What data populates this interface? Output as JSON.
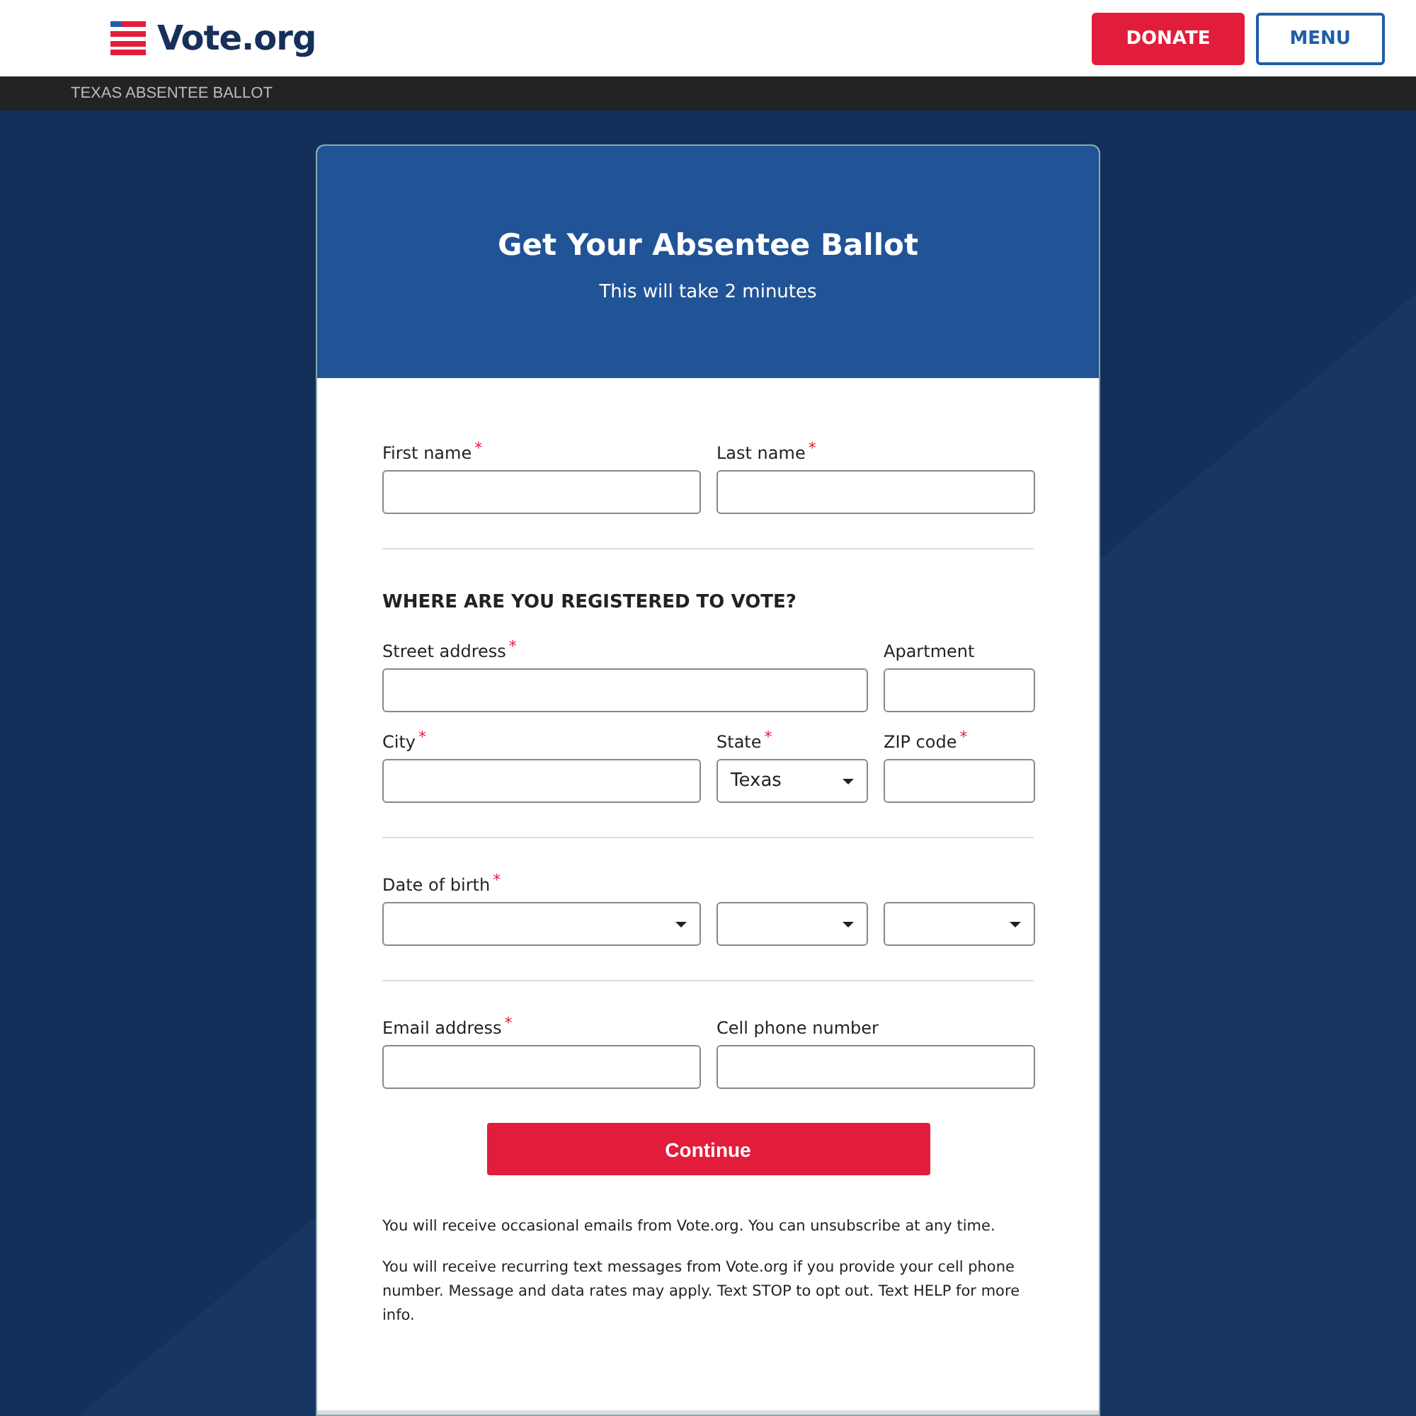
{
  "header": {
    "logo": "Vote.org",
    "buttons": [
      {
        "label": "DONATE",
        "kind": "primary"
      },
      {
        "label": "MENU",
        "kind": "outline"
      }
    ]
  },
  "breadcrumb": "TEXAS ABSENTEE BALLOT",
  "card": {
    "title": "Get Your Absentee Ballot",
    "subtitle": "This will take 2 minutes"
  },
  "sections": [
    {
      "fields": [
        {
          "label": "First name",
          "mark": "*",
          "kind": "text"
        },
        {
          "label": "Last name",
          "mark": "*",
          "kind": "text"
        }
      ]
    },
    {
      "heading": "WHERE ARE YOU REGISTERED TO VOTE?",
      "fields": [
        {
          "label": "Street address",
          "mark": "*",
          "kind": "text"
        },
        {
          "label": "Apartment",
          "kind": "text"
        },
        {
          "label": "City",
          "mark": "*",
          "kind": "text"
        },
        {
          "label": "State",
          "mark": "*",
          "kind": "select",
          "value": "Texas"
        },
        {
          "label": "ZIP code",
          "mark": "*",
          "kind": "text"
        }
      ]
    },
    {
      "fields": [
        {
          "label": "Date of birth",
          "mark": "*",
          "kind": "date"
        }
      ]
    },
    {
      "fields": [
        {
          "label": "Email address",
          "mark": "*",
          "kind": "text"
        },
        {
          "label": "Cell phone number",
          "kind": "text"
        }
      ]
    }
  ],
  "submit": "Continue",
  "notes": [
    "You will receive occasional emails from Vote.org. You can unsubscribe at any time.",
    "You will receive recurring text messages from Vote.org if you provide your cell phone number. Message and data rates may apply. Text STOP to opt out. Text HELP for more info."
  ]
}
